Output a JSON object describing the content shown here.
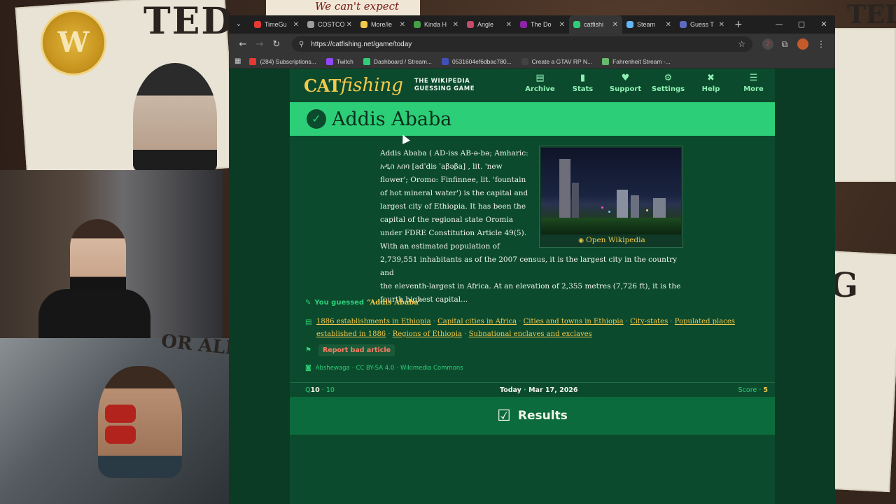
{
  "stream": {
    "poster_word_top": "TED",
    "poster_word_right": "G",
    "poster_word_left": "OR ALIVE",
    "poster_word_top_right": "TED",
    "top_banner": "We can't expect",
    "badge_letter": "W"
  },
  "browser": {
    "tabs": [
      {
        "label": "TimeGu",
        "color": "#e53935"
      },
      {
        "label": "COSTCO",
        "color": "#9e9e9e"
      },
      {
        "label": "More/le",
        "color": "#f2c94c"
      },
      {
        "label": "Kinda H",
        "color": "#43a047"
      },
      {
        "label": "Angle",
        "color": "#c44a6a"
      },
      {
        "label": "The Do",
        "color": "#8e24aa"
      },
      {
        "label": "catfishi",
        "color": "#2ccf78"
      },
      {
        "label": "Steam",
        "color": "#64b5f6"
      },
      {
        "label": "Guess T",
        "color": "#5c6bc0"
      }
    ],
    "active_tab_index": 6,
    "url": "https://catfishing.net/game/today",
    "extension_badge": "2",
    "bookmarks": [
      {
        "label": "(284) Subscriptions...",
        "color": "#e53935"
      },
      {
        "label": "Twitch",
        "color": "#9146ff"
      },
      {
        "label": "Dashboard / Stream...",
        "color": "#2ccf78"
      },
      {
        "label": "0531604ef6dbac780...",
        "color": "#3f51b5"
      },
      {
        "label": "Create a GTAV RP N...",
        "color": "#424242"
      },
      {
        "label": "Fahrenheit Stream -...",
        "color": "#66bb6a"
      }
    ]
  },
  "site": {
    "logo_cat": "CAT",
    "logo_fish": "fishing",
    "tagline_line1": "THE WIKIPEDIA",
    "tagline_line2": "GUESSING GAME",
    "nav": [
      {
        "label": "Archive",
        "icon": "archive-icon",
        "glyph": "▤"
      },
      {
        "label": "Stats",
        "icon": "stats-icon",
        "glyph": "▮"
      },
      {
        "label": "Support",
        "icon": "heart-icon",
        "glyph": "♥"
      },
      {
        "label": "Settings",
        "icon": "gear-icon",
        "glyph": "⚙"
      },
      {
        "label": "Help",
        "icon": "help-icon",
        "glyph": "✖"
      },
      {
        "label": "More",
        "icon": "menu-icon",
        "glyph": "☰"
      }
    ],
    "title": "Addis Ababa",
    "article_lines_narrow": [
      "Addis Ababa ( AD-iss AB-ə-bə; Amharic:",
      "አዲስ አበባ [adˈdis ˈaβəβa] , lit. 'new",
      "flower'; Oromo: Finfinnee, lit. 'fountain",
      "of hot mineral water') is the capital and",
      "largest city of Ethiopia. It has been the",
      "capital of the regional state Oromia",
      "under FDRE Constitution Article 49(5).",
      "With an estimated population of"
    ],
    "article_lines_wide": [
      "2,739,551 inhabitants as of the 2007 census, it is the largest city in the country and",
      "the eleventh-largest in Africa. At an elevation of 2,355 metres (7,726 ft), it is the",
      "fourth highest capital..."
    ],
    "open_wikipedia": "Open Wikipedia",
    "you_guessed_label": "You guessed",
    "guess_value": "“Addis Ababa”",
    "categories": [
      "1886 establishments in Ethiopia",
      "Capital cities in Africa",
      "Cities and towns in Ethiopia",
      "City-states",
      "Populated places established in 1886",
      "Regions of Ethiopia",
      "Subnational enclaves and exclaves"
    ],
    "category_separator": "·",
    "report_label": "Report bad article",
    "credits": [
      "Abshewaga",
      "CC BY-SA 4.0",
      "Wikimedia Commons"
    ],
    "status_q_prefix": "Q",
    "status_q_current": "10",
    "status_q_sep": "·",
    "status_q_total": "10",
    "status_today_label": "Today",
    "status_date": "Mar 17, 2026",
    "status_score_label": "Score",
    "status_score_value": "5",
    "results_label": "Results"
  }
}
